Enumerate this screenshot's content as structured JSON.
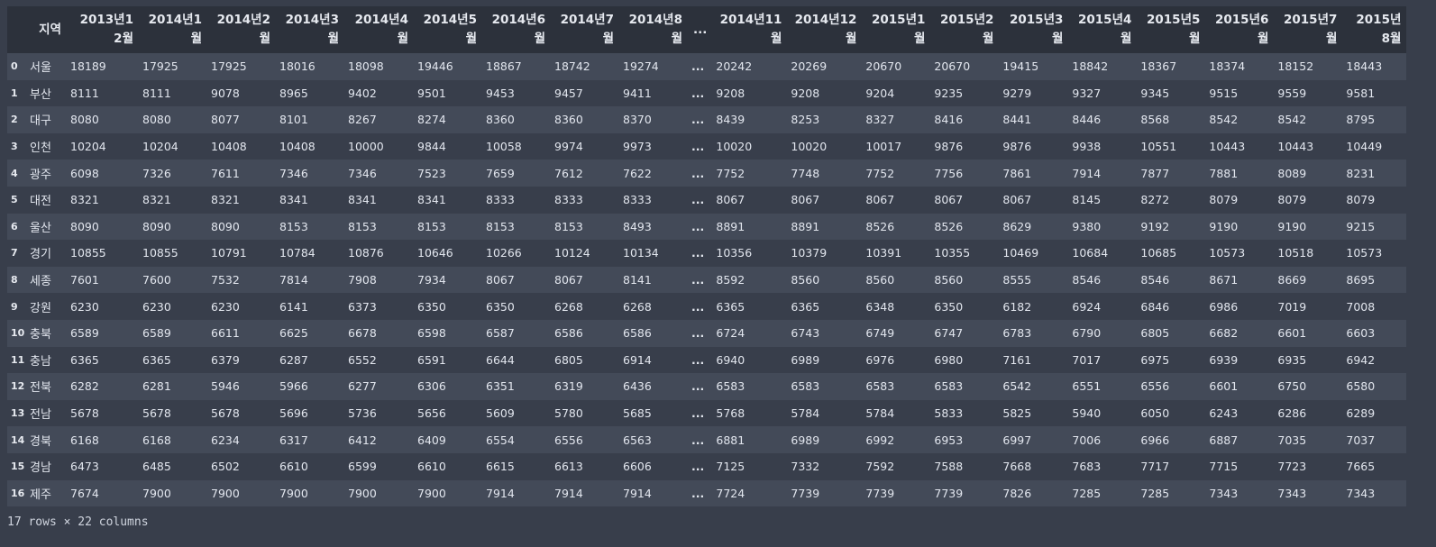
{
  "table": {
    "index_header": "",
    "region_header": "지역",
    "ellipsis": "...",
    "columns_left": [
      "2013년12월",
      "2014년1월",
      "2014년2월",
      "2014년3월",
      "2014년4월",
      "2014년5월",
      "2014년6월",
      "2014년7월",
      "2014년8월"
    ],
    "columns_right": [
      "2014년11월",
      "2014년12월",
      "2015년1월",
      "2015년2월",
      "2015년3월",
      "2015년4월",
      "2015년5월",
      "2015년6월",
      "2015년7월",
      "2015년8월"
    ],
    "rows": [
      {
        "index": "0",
        "region": "서울",
        "left": [
          "18189",
          "17925",
          "17925",
          "18016",
          "18098",
          "19446",
          "18867",
          "18742",
          "19274"
        ],
        "right": [
          "20242",
          "20269",
          "20670",
          "20670",
          "19415",
          "18842",
          "18367",
          "18374",
          "18152",
          "18443"
        ]
      },
      {
        "index": "1",
        "region": "부산",
        "left": [
          "8111",
          "8111",
          "9078",
          "8965",
          "9402",
          "9501",
          "9453",
          "9457",
          "9411"
        ],
        "right": [
          "9208",
          "9208",
          "9204",
          "9235",
          "9279",
          "9327",
          "9345",
          "9515",
          "9559",
          "9581"
        ]
      },
      {
        "index": "2",
        "region": "대구",
        "left": [
          "8080",
          "8080",
          "8077",
          "8101",
          "8267",
          "8274",
          "8360",
          "8360",
          "8370"
        ],
        "right": [
          "8439",
          "8253",
          "8327",
          "8416",
          "8441",
          "8446",
          "8568",
          "8542",
          "8542",
          "8795"
        ]
      },
      {
        "index": "3",
        "region": "인천",
        "left": [
          "10204",
          "10204",
          "10408",
          "10408",
          "10000",
          "9844",
          "10058",
          "9974",
          "9973"
        ],
        "right": [
          "10020",
          "10020",
          "10017",
          "9876",
          "9876",
          "9938",
          "10551",
          "10443",
          "10443",
          "10449"
        ]
      },
      {
        "index": "4",
        "region": "광주",
        "left": [
          "6098",
          "7326",
          "7611",
          "7346",
          "7346",
          "7523",
          "7659",
          "7612",
          "7622"
        ],
        "right": [
          "7752",
          "7748",
          "7752",
          "7756",
          "7861",
          "7914",
          "7877",
          "7881",
          "8089",
          "8231"
        ]
      },
      {
        "index": "5",
        "region": "대전",
        "left": [
          "8321",
          "8321",
          "8321",
          "8341",
          "8341",
          "8341",
          "8333",
          "8333",
          "8333"
        ],
        "right": [
          "8067",
          "8067",
          "8067",
          "8067",
          "8067",
          "8145",
          "8272",
          "8079",
          "8079",
          "8079"
        ]
      },
      {
        "index": "6",
        "region": "울산",
        "left": [
          "8090",
          "8090",
          "8090",
          "8153",
          "8153",
          "8153",
          "8153",
          "8153",
          "8493"
        ],
        "right": [
          "8891",
          "8891",
          "8526",
          "8526",
          "8629",
          "9380",
          "9192",
          "9190",
          "9190",
          "9215"
        ]
      },
      {
        "index": "7",
        "region": "경기",
        "left": [
          "10855",
          "10855",
          "10791",
          "10784",
          "10876",
          "10646",
          "10266",
          "10124",
          "10134"
        ],
        "right": [
          "10356",
          "10379",
          "10391",
          "10355",
          "10469",
          "10684",
          "10685",
          "10573",
          "10518",
          "10573"
        ]
      },
      {
        "index": "8",
        "region": "세종",
        "left": [
          "7601",
          "7600",
          "7532",
          "7814",
          "7908",
          "7934",
          "8067",
          "8067",
          "8141"
        ],
        "right": [
          "8592",
          "8560",
          "8560",
          "8560",
          "8555",
          "8546",
          "8546",
          "8671",
          "8669",
          "8695"
        ]
      },
      {
        "index": "9",
        "region": "강원",
        "left": [
          "6230",
          "6230",
          "6230",
          "6141",
          "6373",
          "6350",
          "6350",
          "6268",
          "6268"
        ],
        "right": [
          "6365",
          "6365",
          "6348",
          "6350",
          "6182",
          "6924",
          "6846",
          "6986",
          "7019",
          "7008"
        ]
      },
      {
        "index": "10",
        "region": "충북",
        "left": [
          "6589",
          "6589",
          "6611",
          "6625",
          "6678",
          "6598",
          "6587",
          "6586",
          "6586"
        ],
        "right": [
          "6724",
          "6743",
          "6749",
          "6747",
          "6783",
          "6790",
          "6805",
          "6682",
          "6601",
          "6603"
        ]
      },
      {
        "index": "11",
        "region": "충남",
        "left": [
          "6365",
          "6365",
          "6379",
          "6287",
          "6552",
          "6591",
          "6644",
          "6805",
          "6914"
        ],
        "right": [
          "6940",
          "6989",
          "6976",
          "6980",
          "7161",
          "7017",
          "6975",
          "6939",
          "6935",
          "6942"
        ]
      },
      {
        "index": "12",
        "region": "전북",
        "left": [
          "6282",
          "6281",
          "5946",
          "5966",
          "6277",
          "6306",
          "6351",
          "6319",
          "6436"
        ],
        "right": [
          "6583",
          "6583",
          "6583",
          "6583",
          "6542",
          "6551",
          "6556",
          "6601",
          "6750",
          "6580"
        ]
      },
      {
        "index": "13",
        "region": "전남",
        "left": [
          "5678",
          "5678",
          "5678",
          "5696",
          "5736",
          "5656",
          "5609",
          "5780",
          "5685"
        ],
        "right": [
          "5768",
          "5784",
          "5784",
          "5833",
          "5825",
          "5940",
          "6050",
          "6243",
          "6286",
          "6289"
        ]
      },
      {
        "index": "14",
        "region": "경북",
        "left": [
          "6168",
          "6168",
          "6234",
          "6317",
          "6412",
          "6409",
          "6554",
          "6556",
          "6563"
        ],
        "right": [
          "6881",
          "6989",
          "6992",
          "6953",
          "6997",
          "7006",
          "6966",
          "6887",
          "7035",
          "7037"
        ]
      },
      {
        "index": "15",
        "region": "경남",
        "left": [
          "6473",
          "6485",
          "6502",
          "6610",
          "6599",
          "6610",
          "6615",
          "6613",
          "6606"
        ],
        "right": [
          "7125",
          "7332",
          "7592",
          "7588",
          "7668",
          "7683",
          "7717",
          "7715",
          "7723",
          "7665"
        ]
      },
      {
        "index": "16",
        "region": "제주",
        "left": [
          "7674",
          "7900",
          "7900",
          "7900",
          "7900",
          "7900",
          "7914",
          "7914",
          "7914"
        ],
        "right": [
          "7724",
          "7739",
          "7739",
          "7739",
          "7826",
          "7285",
          "7285",
          "7343",
          "7343",
          "7343"
        ]
      }
    ]
  },
  "footer": {
    "summary": "17 rows × 22 columns"
  }
}
